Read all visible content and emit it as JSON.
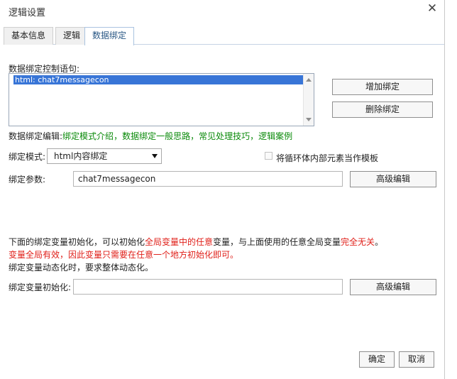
{
  "dialog": {
    "title": "逻辑设置",
    "close_glyph": "✕"
  },
  "tabs": [
    {
      "label": "基本信息",
      "active": false
    },
    {
      "label": "逻辑",
      "active": false
    },
    {
      "label": "数据绑定",
      "active": true
    }
  ],
  "binding": {
    "list_label": "数据绑定控制语句:",
    "list_items": [
      "html: chat7messagecon"
    ],
    "add_button": "增加绑定",
    "delete_button": "删除绑定",
    "help_prefix": "数据绑定编辑:",
    "help_links": [
      "绑定模式介绍",
      "数据绑定一般思路",
      "常见处理技巧",
      "逻辑案例"
    ],
    "help_separator": "，",
    "mode_label": "绑定模式:",
    "mode_value": "html内容绑定",
    "loop_template_checked": false,
    "loop_template_label": "将循环体内部元素当作模板",
    "params_label": "绑定参数:",
    "params_value": "chat7messagecon",
    "advanced_button": "高级编辑"
  },
  "notes": {
    "line1_a": "下面的绑定变量初始化，可以初始化",
    "line1_b": "全局变量中的任意",
    "line1_c": "变量，与上面使用的任意全局变量",
    "line1_d": "完全无关",
    "line1_e": "。",
    "line2": "变量全局有效，因此变量只需要在任意一个地方初始化即可。",
    "line3": "绑定变量动态化时，要求整体动态化。"
  },
  "init": {
    "label": "绑定变量初始化:",
    "value": "",
    "advanced_button": "高级编辑"
  },
  "footer": {
    "ok_button": "确定",
    "cancel_button": "取消"
  },
  "colors": {
    "link_green": "#0a8a0a",
    "warning_red": "#e0201a",
    "selection_blue": "#3875d7"
  }
}
